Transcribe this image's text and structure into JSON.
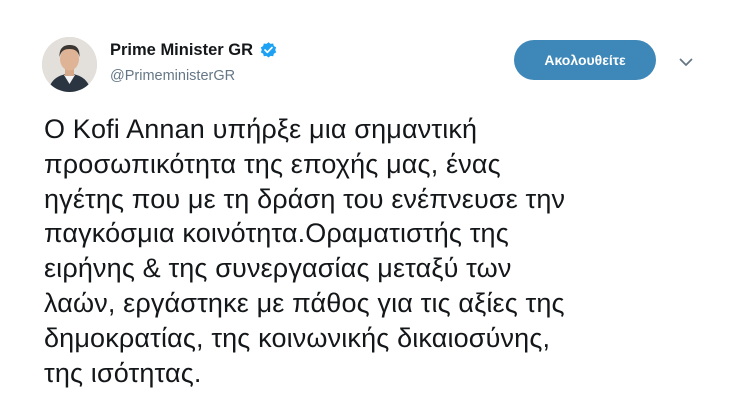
{
  "account": {
    "display_name": "Prime Minister GR",
    "handle": "@PrimeministerGR",
    "verified": true,
    "verified_icon": "verified-badge-icon",
    "avatar_icon": "avatar"
  },
  "actions": {
    "follow_label": "Ακολουθείτε",
    "more_icon": "chevron-down-icon"
  },
  "tweet": {
    "lines": [
      "Ο Kofi Annan υπήρξε μια σημαντική",
      "προσωπικότητα της εποχής μας, ένας",
      "ηγέτης που με τη δράση του ενέπνευσε την",
      "παγκόσμια κοινότητα.Οραματιστής της",
      "ειρήνης & της συνεργασίας μεταξύ των",
      "λαών, εργάστηκε με πάθος για τις αξίες της",
      "δημοκρατίας, της κοινωνικής δικαιοσύνης,",
      "της ισότητας."
    ]
  },
  "colors": {
    "follow_button_bg": "#3d88b8",
    "verified_blue": "#1da1f2",
    "handle_gray": "#657786",
    "text": "#14171a"
  }
}
